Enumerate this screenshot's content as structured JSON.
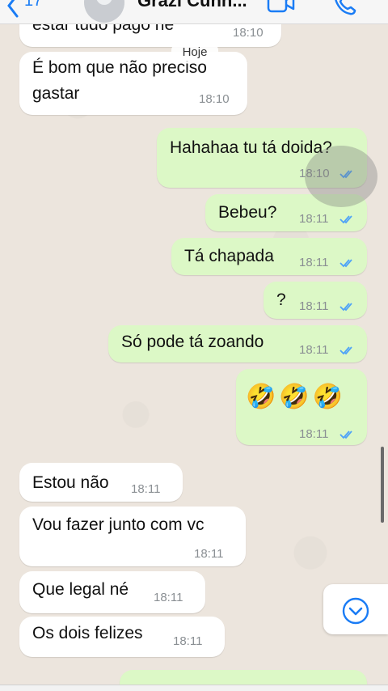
{
  "header": {
    "back_count": "17",
    "contact_name": "Grazi Cunh..."
  },
  "day_separator": "Hoje",
  "messages": [
    {
      "text": "estar tudo pago né",
      "time": "18:10",
      "dir": "in"
    },
    {
      "text_lines": [
        "É bom que não preciso",
        "gastar"
      ],
      "time": "18:10",
      "dir": "in"
    },
    {
      "text": "Hahahaa tu tá doida?",
      "time": "18:10",
      "dir": "out"
    },
    {
      "text": "Bebeu?",
      "time": "18:11",
      "dir": "out"
    },
    {
      "text": "Tá chapada",
      "time": "18:11",
      "dir": "out"
    },
    {
      "text": "?",
      "time": "18:11",
      "dir": "out"
    },
    {
      "text": "Só pode tá zoando",
      "time": "18:11",
      "dir": "out"
    },
    {
      "text": "🤣🤣🤣",
      "time": "18:11",
      "dir": "out"
    },
    {
      "text": "Estou não",
      "time": "18:11",
      "dir": "in"
    },
    {
      "text": "Vou fazer junto com vc",
      "time": "18:11",
      "dir": "in"
    },
    {
      "text": "Que legal né",
      "time": "18:11",
      "dir": "in"
    },
    {
      "text": "Os dois felizes",
      "time": "18:11",
      "dir": "in"
    }
  ],
  "colors": {
    "incoming": "#ffffff",
    "outgoing": "#dcf8c6",
    "read_ticks": "#4fa3f7",
    "accent": "#1a7cf5"
  },
  "icons": [
    "chevron-left-icon",
    "video-call-icon",
    "phone-icon",
    "double-check-icon",
    "chevron-down-icon"
  ]
}
